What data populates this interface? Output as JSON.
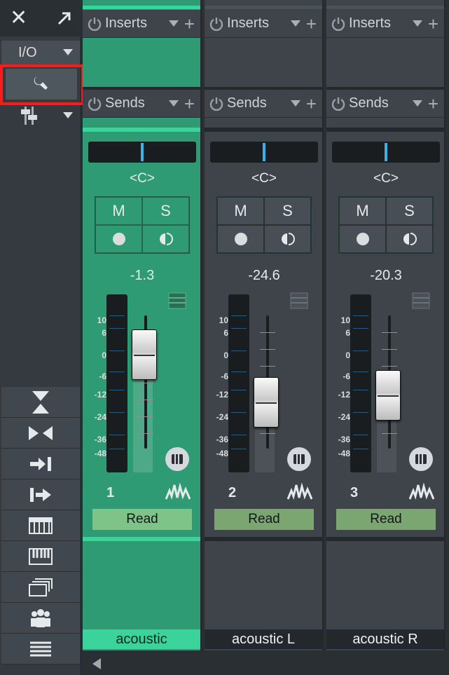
{
  "toolbar": {
    "close_icon": "close-icon",
    "expand_icon": "expand-arrow-icon",
    "io_label": "I/O",
    "wrench_icon": "wrench-icon",
    "faders_icon": "fader-icon",
    "tools": [
      "collapse-icon",
      "expand-horizontal-icon",
      "input-icon",
      "output-icon",
      "keyboard-track-icon",
      "piano-icon",
      "layers-icon",
      "group-icon",
      "list-icon"
    ]
  },
  "channels": [
    {
      "id": "1",
      "name": "acoustic",
      "selected": true,
      "inserts_label": "Inserts",
      "sends_label": "Sends",
      "pan": "<C>",
      "mute": "M",
      "solo": "S",
      "volume": "-1.3",
      "automation": "Read"
    },
    {
      "id": "2",
      "name": "acoustic L",
      "selected": false,
      "inserts_label": "Inserts",
      "sends_label": "Sends",
      "pan": "<C>",
      "mute": "M",
      "solo": "S",
      "volume": "-24.6",
      "automation": "Read"
    },
    {
      "id": "3",
      "name": "acoustic R",
      "selected": false,
      "inserts_label": "Inserts",
      "sends_label": "Sends",
      "pan": "<C>",
      "mute": "M",
      "solo": "S",
      "volume": "-20.3",
      "automation": "Read"
    }
  ],
  "meter_scale": [
    "10",
    "6",
    "0",
    "-6",
    "-12",
    "-24",
    "-36",
    "-48"
  ],
  "colors": {
    "selected_channel": "#2f9b74",
    "accent": "#3bd39c",
    "highlight": "#ff1a1a",
    "read_button": "#7ec489"
  }
}
